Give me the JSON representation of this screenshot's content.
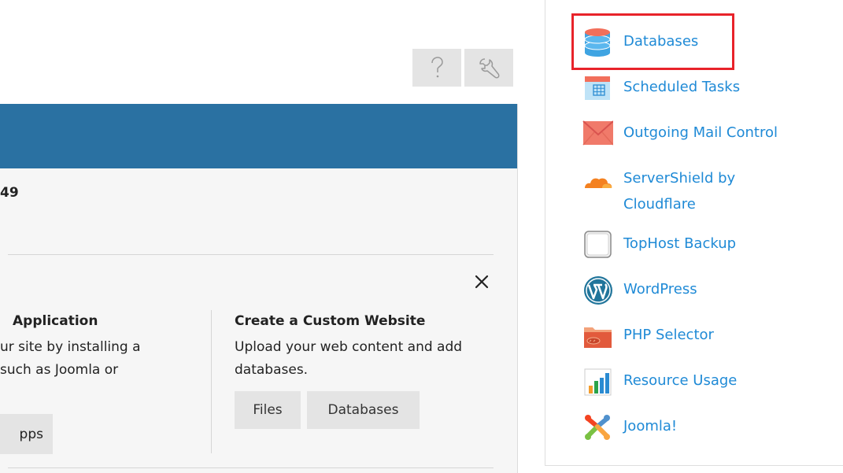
{
  "toolbar": {
    "help_icon": "question-mark-icon",
    "settings_icon": "wrench-icon"
  },
  "panel": {
    "header_color": "#2a71a2",
    "title_fragment": "49",
    "close_symbol": "✕"
  },
  "card_left": {
    "title": " Application",
    "desc_line1": "ur site by installing a",
    "desc_line2": " such as Joomla or",
    "button_label": "pps"
  },
  "card_right": {
    "title": "Create a Custom Website",
    "description": "Upload your web content and add databases.",
    "files_button": "Files",
    "databases_button": "Databases"
  },
  "sidebar": {
    "link_color": "#1f8ad6",
    "highlight_color": "#e8232a",
    "items": [
      {
        "label": "Databases",
        "icon": "database-icon"
      },
      {
        "label": "Scheduled Tasks",
        "icon": "calendar-icon"
      },
      {
        "label": "Outgoing Mail Control",
        "icon": "envelope-icon"
      },
      {
        "label": "ServerShield by Cloudflare",
        "label_line1": "ServerShield by",
        "label_line2": "Cloudflare",
        "icon": "cloud-icon"
      },
      {
        "label": "TopHost Backup",
        "icon": "backup-drive-icon"
      },
      {
        "label": "WordPress",
        "icon": "wordpress-icon"
      },
      {
        "label": "PHP Selector",
        "icon": "php-folder-icon"
      },
      {
        "label": "Resource Usage",
        "icon": "bar-chart-icon"
      },
      {
        "label": "Joomla!",
        "icon": "joomla-icon"
      }
    ]
  }
}
